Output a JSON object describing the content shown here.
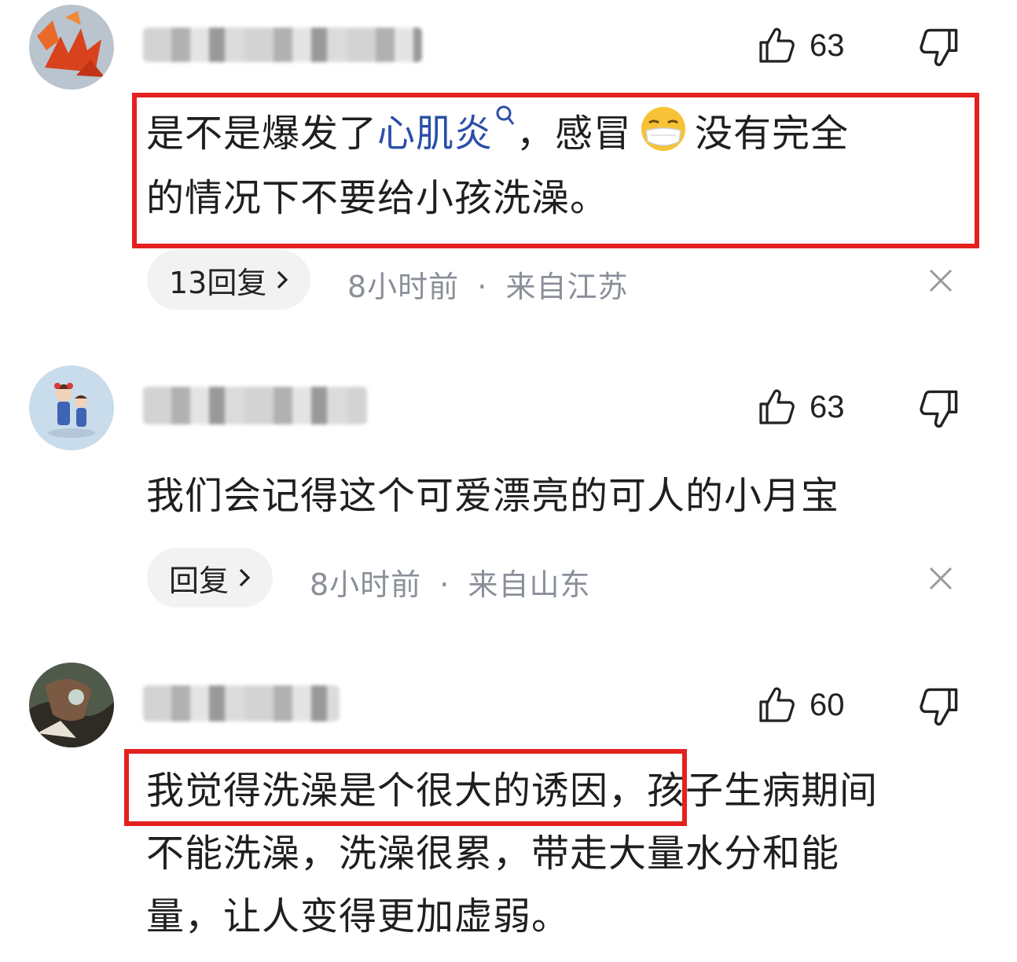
{
  "comments": [
    {
      "like_count": "63",
      "text_before": "是不是爆发了",
      "keyword": "心肌炎",
      "text_mid": "，感冒",
      "text_after": "没有完全",
      "line2": "的情况下不要给小孩洗澡。",
      "reply_label": "13回复",
      "time": "8小时前",
      "dot": "·",
      "location": "来自江苏",
      "icons": [
        "thumbs-up-icon",
        "thumbs-down-icon",
        "search-icon",
        "mask-face-emoji",
        "chevron-right-icon",
        "close-icon"
      ]
    },
    {
      "like_count": "63",
      "text": "我们会记得这个可爱漂亮的可人的小月宝",
      "reply_label": "回复",
      "time": "8小时前",
      "dot": "·",
      "location": "来自山东"
    },
    {
      "like_count": "60",
      "line1_highlight": "我觉得洗澡是个很大的诱因",
      "line1_rest": "，孩子生病期间",
      "line2": "不能洗澡，洗澡很累，带走大量水分和能",
      "line3": "量，让人变得更加虚弱。"
    }
  ],
  "colors": {
    "highlight_border": "#e3211f",
    "keyword": "#2b4fa8",
    "meta_text": "#8a8f99",
    "pill_bg": "#f2f2f2"
  }
}
